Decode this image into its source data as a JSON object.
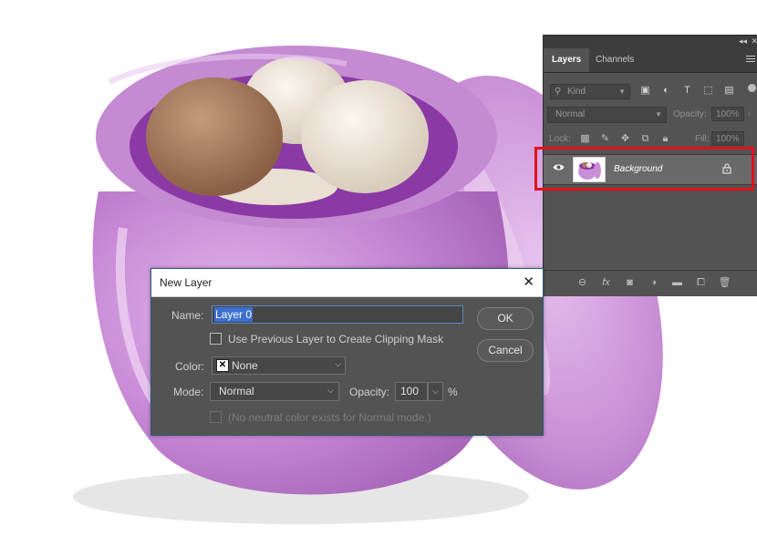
{
  "layers_panel": {
    "tabs": [
      "Layers",
      "Channels"
    ],
    "filter": {
      "kind_label": "Kind"
    },
    "blend_mode": "Normal",
    "opacity_label": "Opacity:",
    "opacity_value": "100%",
    "lock_label": "Lock:",
    "fill_label": "Fill:",
    "fill_value": "100%",
    "layers": [
      {
        "name": "Background",
        "visible": true,
        "locked": true
      }
    ],
    "highlight_color": "#e0121b"
  },
  "dialog": {
    "title": "New Layer",
    "name_label": "Name:",
    "name_value": "Layer 0",
    "clipping_mask_label": "Use Previous Layer to Create Clipping Mask",
    "clipping_mask_checked": false,
    "color_label": "Color:",
    "color_value": "None",
    "mode_label": "Mode:",
    "mode_value": "Normal",
    "opacity_label": "Opacity:",
    "opacity_value": "100",
    "percent_sign": "%",
    "neutral_label": "(No neutral color exists for Normal mode.)",
    "neutral_checked": false,
    "ok_label": "OK",
    "cancel_label": "Cancel"
  },
  "colors": {
    "panel_bg": "#535353",
    "selection": "#3b6fd0",
    "bowl_purple": "#c98fd6"
  }
}
